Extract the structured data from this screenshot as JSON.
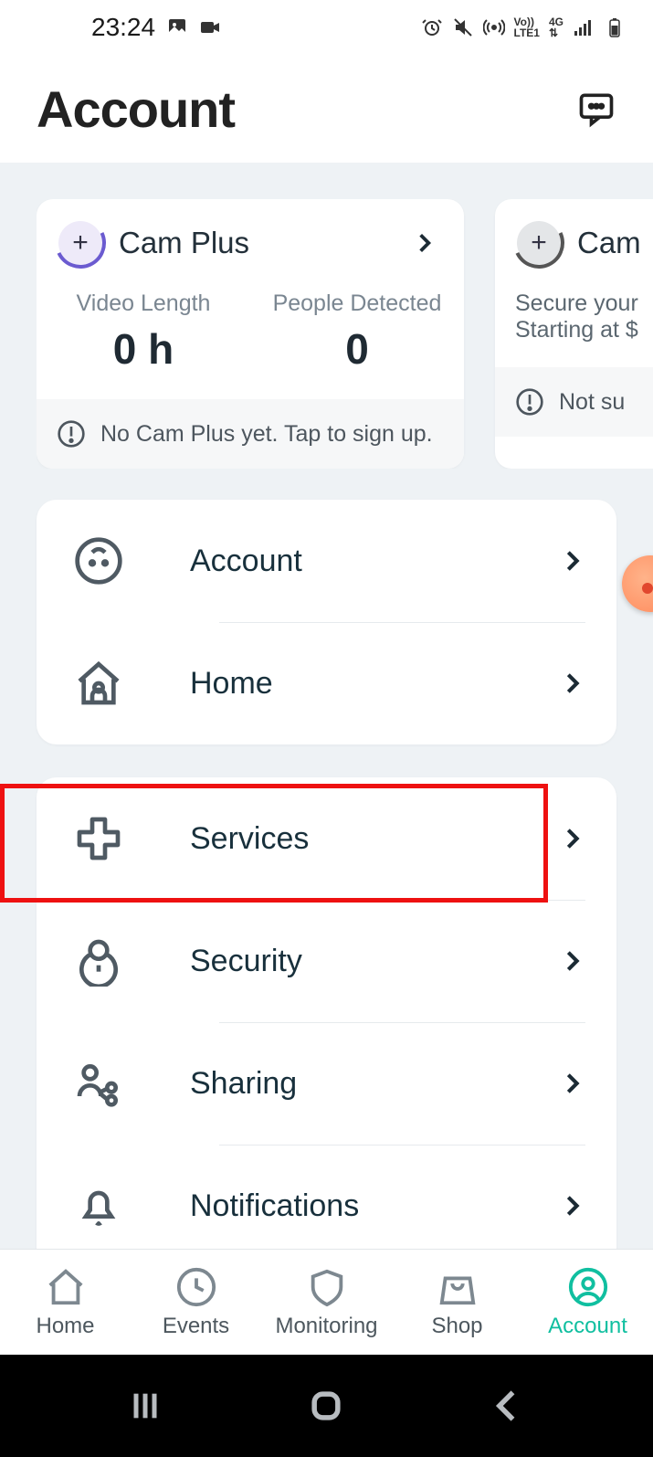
{
  "status": {
    "time": "23:24"
  },
  "header": {
    "title": "Account"
  },
  "promo": {
    "card1": {
      "title": "Cam Plus",
      "stat1_label": "Video Length",
      "stat1_value": "0 h",
      "stat2_label": "People Detected",
      "stat2_value": "0",
      "footer": "No Cam Plus yet. Tap to sign up."
    },
    "card2": {
      "title": "Cam",
      "desc_line1": "Secure your",
      "desc_line2": "Starting at $",
      "footer": "Not su"
    }
  },
  "list1": {
    "item0": "Account",
    "item1": "Home"
  },
  "list2": {
    "item0": "Services",
    "item1": "Security",
    "item2": "Sharing",
    "item3": "Notifications"
  },
  "tabs": {
    "home": "Home",
    "events": "Events",
    "monitoring": "Monitoring",
    "shop": "Shop",
    "account": "Account"
  }
}
